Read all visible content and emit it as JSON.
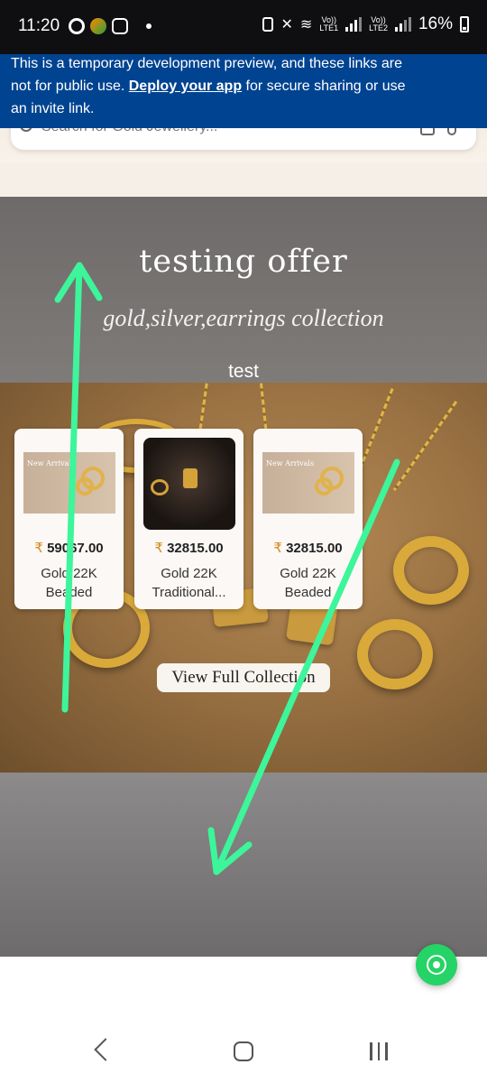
{
  "status_bar": {
    "time": "11:20",
    "lte1_top": "Vo))",
    "lte1_bottom": "LTE1",
    "lte2_top": "Vo))",
    "lte2_bottom": "LTE2",
    "battery": "16%"
  },
  "dev_notice": {
    "text_before": "This is a temporary development preview, and these links are not for public use. ",
    "link_text": "Deploy your app",
    "text_after": " for secure sharing or use an invite link."
  },
  "search": {
    "placeholder": "Search for Gold Jewellery..."
  },
  "offer": {
    "title": "testing offer",
    "subtitle": "gold,silver,earrings collection",
    "caption": "test"
  },
  "products": [
    {
      "image_title": "New Arrivals",
      "price": "59067.00",
      "name": "Gold 22K Beaded"
    },
    {
      "image_title": "",
      "price": "32815.00",
      "name": "Gold 22K Traditional..."
    },
    {
      "image_title": "New Arrivals",
      "price": "32815.00",
      "name": "Gold 22K Beaded"
    }
  ],
  "currency_symbol": "₹",
  "view_collection_label": "View Full Collection",
  "colors": {
    "dev_notice_bg": "#004391",
    "whatsapp_green": "#25d366",
    "annotation_arrow": "#3df59a",
    "price_symbol": "#d08a1c"
  },
  "icons": {
    "status_left": [
      "chrome-icon",
      "app-icon",
      "instagram-icon",
      "notification-dot-icon"
    ],
    "status_right": [
      "vpn-icon",
      "mute-icon",
      "wifi-icon",
      "signal-icon",
      "battery-icon"
    ],
    "search": [
      "search-icon",
      "camera-icon",
      "mic-icon"
    ],
    "floating": "whatsapp-icon",
    "nav": [
      "back-icon",
      "home-icon",
      "recent-apps-icon"
    ]
  }
}
